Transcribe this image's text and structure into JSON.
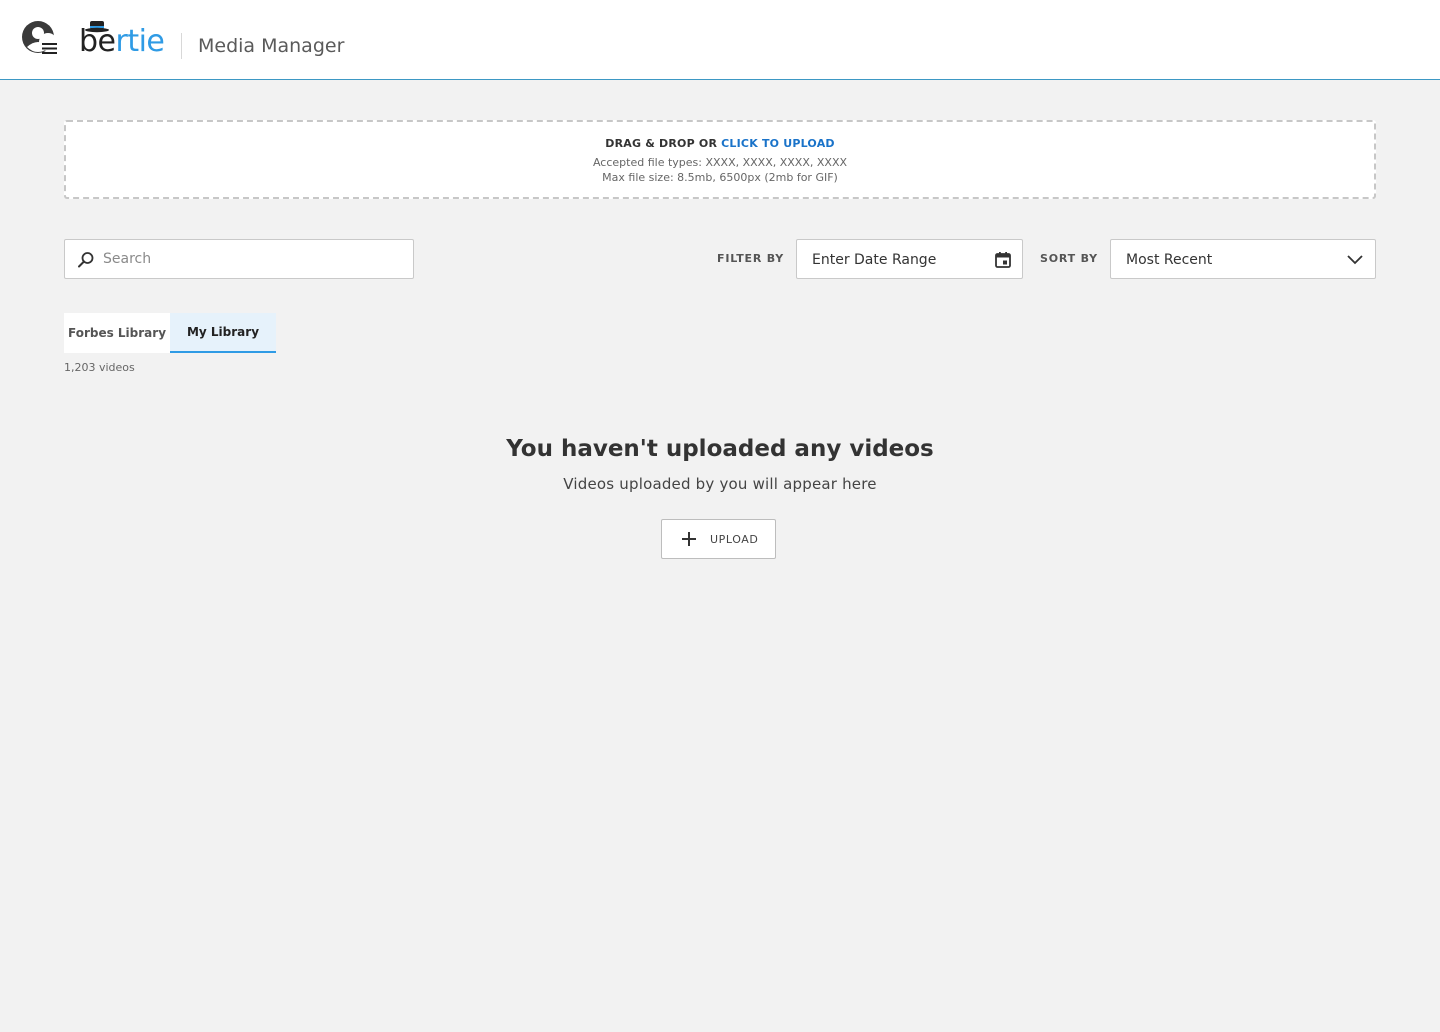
{
  "header": {
    "logo_text_dark": "be",
    "logo_text_accent": "rtie",
    "app_title": "Media Manager"
  },
  "upload_zone": {
    "title_prefix": "DRAG & DROP OR ",
    "title_link": "CLICK TO UPLOAD",
    "file_types": "Accepted file types: XXXX, XXXX, XXXX, XXXX",
    "max_size": "Max file size: 8.5mb, 6500px  (2mb for GIF)"
  },
  "search": {
    "placeholder": "Search"
  },
  "filter": {
    "label": "FILTER BY",
    "value": "Enter Date Range"
  },
  "sort": {
    "label": "SORT BY",
    "value": "Most Recent"
  },
  "tabs": [
    {
      "label": "Forbes Library",
      "active": false
    },
    {
      "label": "My Library",
      "active": true
    }
  ],
  "video_count": "1,203 videos",
  "empty_state": {
    "title": "You haven't uploaded any videos",
    "subtitle": "Videos uploaded by you will appear here",
    "button_label": "UPLOAD"
  },
  "colors": {
    "accent": "#2f9be5",
    "link": "#1a73c9",
    "background": "#f2f2f2",
    "header_border": "#3d98c4"
  }
}
